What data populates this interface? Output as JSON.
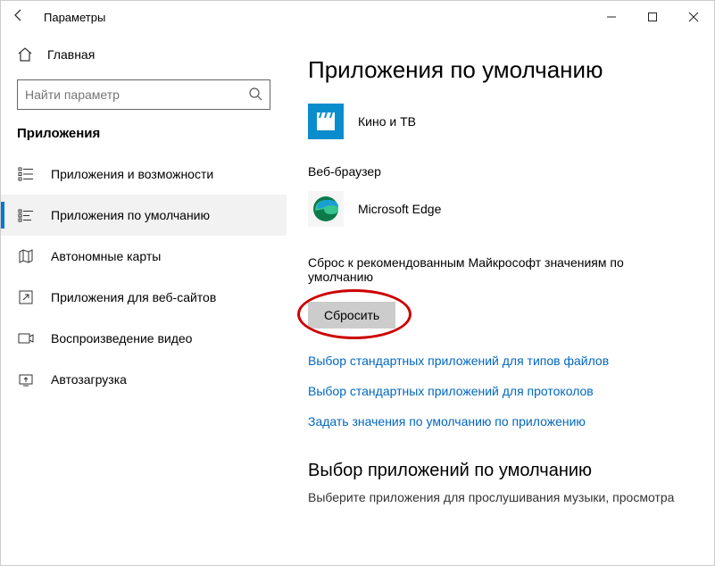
{
  "window": {
    "title": "Параметры"
  },
  "sidebar": {
    "home_label": "Главная",
    "search_placeholder": "Найти параметр",
    "section_title": "Приложения",
    "items": [
      {
        "label": "Приложения и возможности"
      },
      {
        "label": "Приложения по умолчанию"
      },
      {
        "label": "Автономные карты"
      },
      {
        "label": "Приложения для веб-сайтов"
      },
      {
        "label": "Воспроизведение видео"
      },
      {
        "label": "Автозагрузка"
      }
    ]
  },
  "main": {
    "heading": "Приложения по умолчанию",
    "video_app": "Кино и ТВ",
    "browser_label": "Веб-браузер",
    "browser_app": "Microsoft Edge",
    "reset_heading": "Сброс к рекомендованным Майкрософт значениям по умолчанию",
    "reset_button": "Сбросить",
    "links": [
      "Выбор стандартных приложений для типов файлов",
      "Выбор стандартных приложений для протоколов",
      "Задать значения по умолчанию по приложению"
    ],
    "sub_heading": "Выбор приложений по умолчанию",
    "sub_text": "Выберите приложения для прослушивания музыки, просмотра"
  }
}
